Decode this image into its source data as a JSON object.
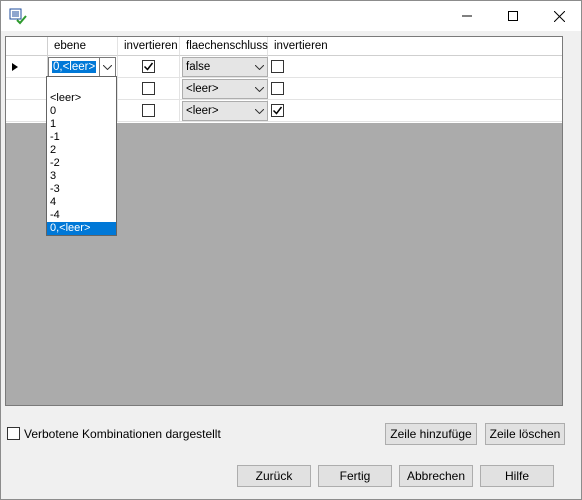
{
  "columns": [
    "ebene",
    "invertieren",
    "flaechenschluss",
    "invertieren"
  ],
  "rows": [
    {
      "ebene": "0,<leer>",
      "inv1": true,
      "flaeche": "false",
      "inv2": false
    },
    {
      "ebene": "",
      "inv1": false,
      "flaeche": "<leer>",
      "inv2": false
    },
    {
      "ebene": "",
      "inv1": false,
      "flaeche": "<leer>",
      "inv2": true
    }
  ],
  "dropdown": {
    "options": [
      "",
      "<leer>",
      "0",
      "1",
      "-1",
      "2",
      "-2",
      "3",
      "-3",
      "4",
      "-4",
      "0,<leer>"
    ],
    "selected": "0,<leer>"
  },
  "checkbox_label": "Verbotene Kombinationen dargestellt",
  "buttons": {
    "add_row": "Zeile hinzufüge",
    "delete_row": "Zeile löschen",
    "back": "Zurück",
    "finish": "Fertig",
    "cancel": "Abbrechen",
    "help": "Hilfe"
  },
  "colors": {
    "selection": "#0078d7",
    "grid_background": "#ababab"
  }
}
